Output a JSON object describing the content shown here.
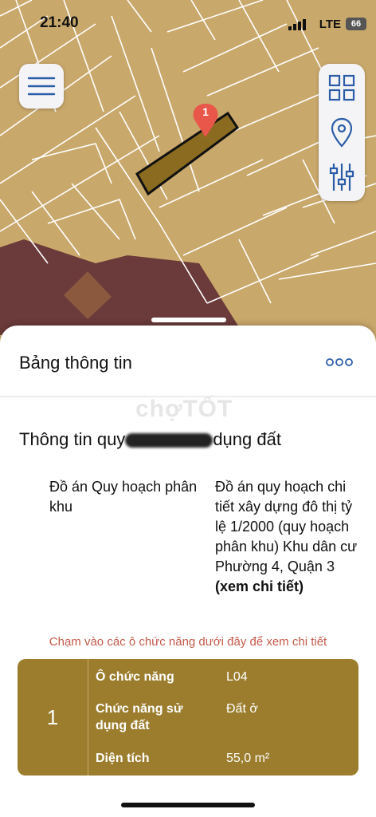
{
  "status_bar": {
    "time": "21:40",
    "network": "LTE",
    "battery": "66"
  },
  "map": {
    "marker_label": "1",
    "colors": {
      "land": "#c9a86b",
      "lines": "#ffffff",
      "dark_zone": "#6b3a3a",
      "selected_parcel": "#8a6b1f",
      "marker": "#e8574a"
    }
  },
  "sheet": {
    "title": "Bảng thông tin",
    "watermark": "chợTỐT",
    "section_title_start": "Thông tin quy",
    "section_title_end": "dụng đất",
    "rows": [
      {
        "key": "Đồ án Quy hoạch phân khu",
        "value": "Đồ án quy hoạch chi tiết xây dựng đô thị tỷ lệ 1/2000 (quy hoạch phân khu) Khu dân cư Phường 4, Quận 3",
        "link": "(xem chi tiết)"
      }
    ],
    "hint": "Chạm vào các ô chức năng dưới đây để xem chi tiết",
    "function_table": {
      "index": "1",
      "rows": [
        {
          "key": "Ô chức năng",
          "value": "L04"
        },
        {
          "key": "Chức năng sử dụng đất",
          "value": "Đất ở"
        },
        {
          "key": "Diện tích",
          "value": "55,0 m²"
        }
      ]
    }
  }
}
